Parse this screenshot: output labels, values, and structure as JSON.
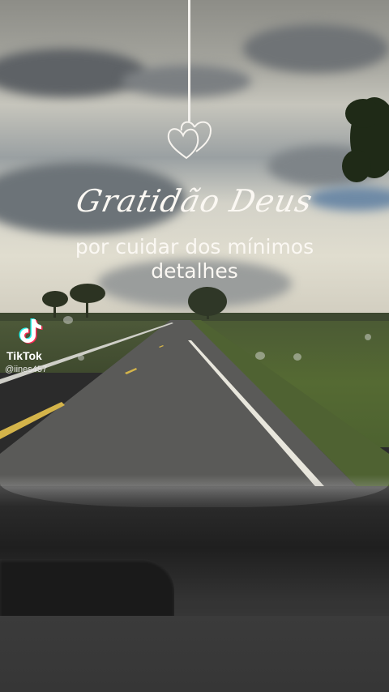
{
  "overlay": {
    "title_script": "Gratidão Deus",
    "subtitle_line1": "por cuidar dos mínimos",
    "subtitle_line2": "detalhes"
  },
  "watermark": {
    "brand": "TikTok",
    "username": "@iines457"
  },
  "icons": {
    "hearts": "double-heart-outline-icon",
    "logo": "tiktok-note-icon"
  },
  "colors": {
    "text": "#fbf8f3",
    "road": "#5a5a58",
    "grass": "#4f6232",
    "dashboard": "#2a2a2a"
  }
}
